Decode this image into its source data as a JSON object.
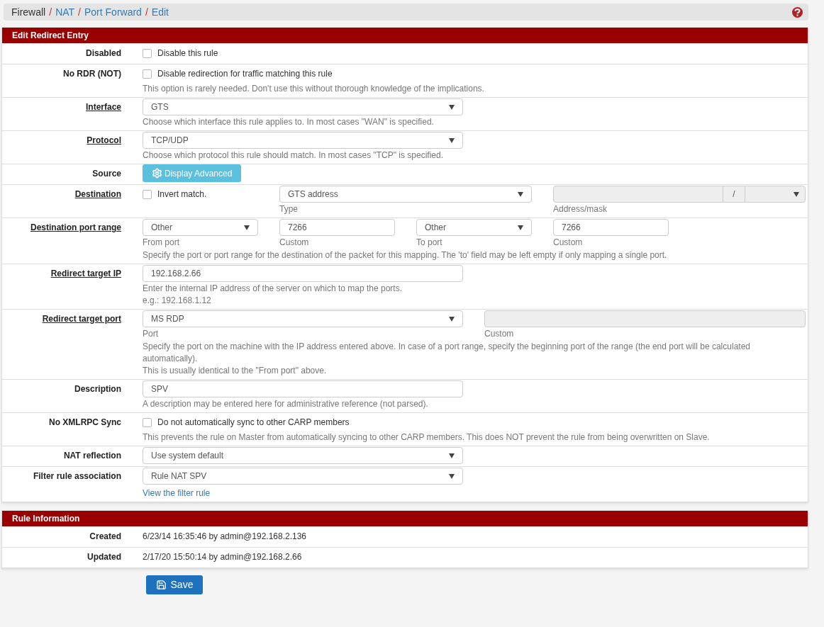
{
  "breadcrumb": [
    {
      "label": "Firewall",
      "link": false,
      "separator": "/"
    },
    {
      "label": "NAT",
      "link": true,
      "separator": "/"
    },
    {
      "label": "Port Forward",
      "link": true,
      "separator": "/"
    },
    {
      "label": "Edit",
      "link": true
    }
  ],
  "sections": [
    {
      "title": "Edit Redirect Entry",
      "rows": [
        {
          "kind": "checkbox",
          "label": "Disabled",
          "required": false,
          "checkbox": {
            "label": "Disable this rule",
            "checked": false
          }
        },
        {
          "kind": "checkbox",
          "label": "No RDR (NOT)",
          "required": false,
          "checkbox": {
            "label": "Disable redirection for traffic matching this rule",
            "checked": false
          },
          "help": [
            "This option is rarely needed. Don't use this without thorough knowledge of the implications."
          ]
        },
        {
          "kind": "select",
          "label": "Interface",
          "required": true,
          "select": {
            "value": "GTS"
          },
          "help": [
            "Choose which interface this rule applies to. In most cases \"WAN\" is specified."
          ]
        },
        {
          "kind": "select",
          "label": "Protocol",
          "required": true,
          "select": {
            "value": "TCP/UDP"
          },
          "help": [
            "Choose which protocol this rule should match. In most cases \"TCP\" is specified."
          ]
        },
        {
          "kind": "button",
          "label": "Source",
          "required": false,
          "button": {
            "label": "Display Advanced"
          }
        },
        {
          "kind": "destination",
          "label": "Destination",
          "required": true,
          "checkbox": {
            "label": "Invert match.",
            "checked": false
          },
          "type_select": {
            "value": "GTS address",
            "caption": "Type"
          },
          "address": {
            "caption": "Address/mask",
            "separator": "/",
            "disabled": true
          }
        },
        {
          "kind": "port_range",
          "label": "Destination port range",
          "required": true,
          "from_port": {
            "value": "Other",
            "caption": "From port"
          },
          "from_custom": {
            "value": "7266",
            "caption": "Custom"
          },
          "to_port": {
            "value": "Other",
            "caption": "To port"
          },
          "to_custom": {
            "value": "7266",
            "caption": "Custom"
          },
          "help": [
            "Specify the port or port range for the destination of the packet for this mapping. The 'to' field may be left empty if only mapping a single port."
          ]
        },
        {
          "kind": "input",
          "label": "Redirect target IP",
          "required": true,
          "input": {
            "value": "192.168.2.66"
          },
          "help": [
            "Enter the internal IP address of the server on which to map the ports.",
            "e.g.: 192.168.1.12"
          ]
        },
        {
          "kind": "target_port",
          "label": "Redirect target port",
          "required": true,
          "port": {
            "value": "MS RDP",
            "caption": "Port"
          },
          "custom": {
            "caption": "Custom",
            "disabled": true
          },
          "help": [
            "Specify the port on the machine with the IP address entered above. In case of a port range, specify the beginning port of the range (the end port will be calculated automatically).",
            "This is usually identical to the \"From port\" above."
          ]
        },
        {
          "kind": "input",
          "label": "Description",
          "required": false,
          "input": {
            "value": "SPV"
          },
          "help": [
            "A description may be entered here for administrative reference (not parsed)."
          ]
        },
        {
          "kind": "checkbox",
          "label": "No XMLRPC Sync",
          "required": false,
          "checkbox": {
            "label": "Do not automatically sync to other CARP members",
            "checked": false
          },
          "help": [
            "This prevents the rule on Master from automatically syncing to other CARP members. This does NOT prevent the rule from being overwritten on Slave."
          ]
        },
        {
          "kind": "select",
          "label": "NAT reflection",
          "required": false,
          "select": {
            "value": "Use system default"
          }
        },
        {
          "kind": "select",
          "label": "Filter rule association",
          "required": false,
          "select": {
            "value": "Rule NAT SPV"
          },
          "link": "View the filter rule"
        }
      ]
    },
    {
      "title": "Rule Information",
      "rows": [
        {
          "kind": "info",
          "label": "Created",
          "value": "6/23/14 16:35:46 by admin@192.168.2.136"
        },
        {
          "kind": "info",
          "label": "Updated",
          "value": "2/17/20 15:50:14 by admin@192.168.2.66"
        }
      ]
    }
  ],
  "save_button": {
    "label": "Save"
  }
}
